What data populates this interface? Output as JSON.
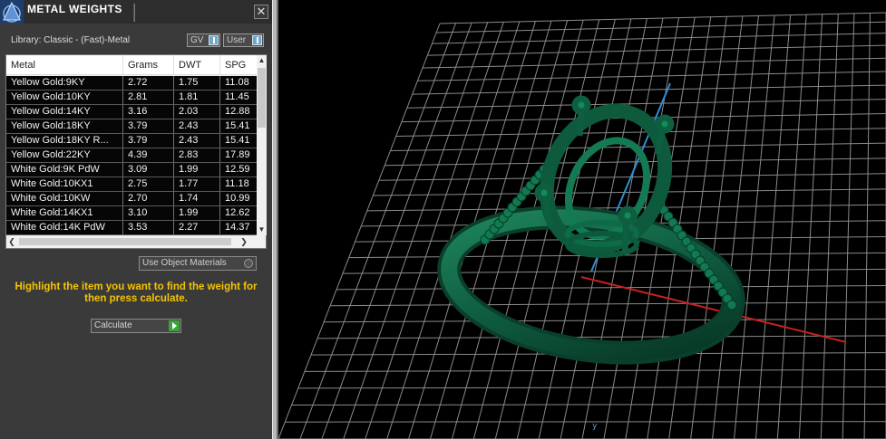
{
  "panel": {
    "title": "METAL WEIGHTS",
    "close_glyph": "✕",
    "library_label": "Library: Classic - (Fast)-Metal",
    "toggle_gv": "GV",
    "toggle_user": "User",
    "columns": [
      "Metal",
      "Grams",
      "DWT",
      "SPG"
    ],
    "rows": [
      [
        "Yellow Gold:9KY",
        "2.72",
        "1.75",
        "11.08"
      ],
      [
        "Yellow Gold:10KY",
        "2.81",
        "1.81",
        "11.45"
      ],
      [
        "Yellow Gold:14KY",
        "3.16",
        "2.03",
        "12.88"
      ],
      [
        "Yellow Gold:18KY",
        "3.79",
        "2.43",
        "15.41"
      ],
      [
        "Yellow Gold:18KY R...",
        "3.79",
        "2.43",
        "15.41"
      ],
      [
        "Yellow Gold:22KY",
        "4.39",
        "2.83",
        "17.89"
      ],
      [
        "White Gold:9K PdW",
        "3.09",
        "1.99",
        "12.59"
      ],
      [
        "White Gold:10KX1",
        "2.75",
        "1.77",
        "11.18"
      ],
      [
        "White Gold:10KW",
        "2.70",
        "1.74",
        "10.99"
      ],
      [
        "White Gold:14KX1",
        "3.10",
        "1.99",
        "12.62"
      ],
      [
        "White Gold:14K PdW",
        "3.53",
        "2.27",
        "14.37"
      ]
    ],
    "use_object_materials": "Use Object Materials",
    "hint": "Highlight the item you want to find the weight for then press calculate.",
    "calculate_label": "Calculate"
  },
  "viewport": {
    "axis_label": "y",
    "grid_color": "#8a8a8a",
    "x_axis_color": "#c62020",
    "y_axis_color": "#2f8fd0",
    "ring_color": "#0f5c40"
  },
  "icons": {
    "logo": "app-logo-icon",
    "close": "close-icon",
    "calculate": "play-arrow-icon"
  }
}
